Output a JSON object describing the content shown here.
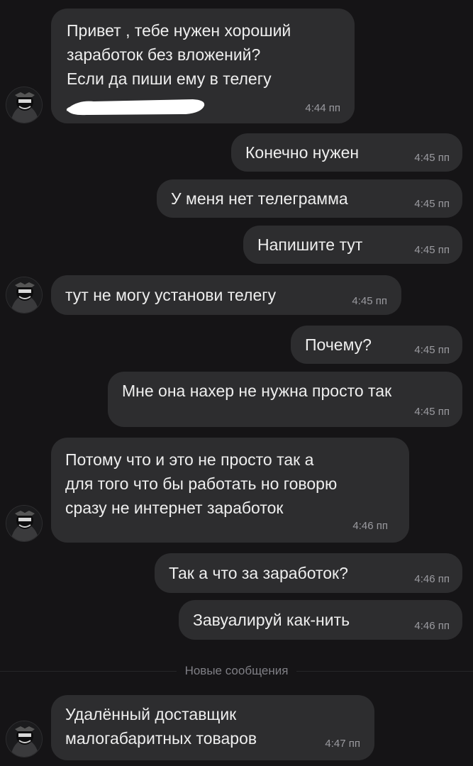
{
  "divider": {
    "label": "Новые сообщения"
  },
  "messages": [
    {
      "from": "them",
      "text": "Привет , тебе нужен хороший\nзаработок без вложений?\nЕсли да пиши ему в телегу",
      "time": "4:44 пп",
      "has_redacted_contact": true
    },
    {
      "from": "me",
      "text": "Конечно нужен",
      "time": "4:45 пп"
    },
    {
      "from": "me",
      "text": "У меня нет телеграмма",
      "time": "4:45 пп"
    },
    {
      "from": "me",
      "text": "Напишите тут",
      "time": "4:45 пп"
    },
    {
      "from": "them",
      "text": "тут не могу установи телегу",
      "time": "4:45 пп"
    },
    {
      "from": "me",
      "text": "Почему?",
      "time": "4:45 пп"
    },
    {
      "from": "me",
      "text": "Мне она нахер не нужна просто так",
      "time": "4:45 пп"
    },
    {
      "from": "them",
      "text": "Потому что и это не просто так а\nдля того что бы работать но говорю\nсразу не интернет заработок",
      "time": "4:46 пп"
    },
    {
      "from": "me",
      "text": "Так а что за заработок?",
      "time": "4:46 пп"
    },
    {
      "from": "me",
      "text": "Завуалируй как-нить",
      "time": "4:46 пп"
    },
    {
      "from": "them",
      "text": "Удалённый доставщик\nмалогабаритных товаров",
      "time": "4:47 пп"
    }
  ],
  "colors": {
    "background": "#151416",
    "bubble": "#2d2d2f",
    "text": "#eeeeee",
    "time": "#9b9ba0",
    "divider_text": "#7f7f85"
  }
}
